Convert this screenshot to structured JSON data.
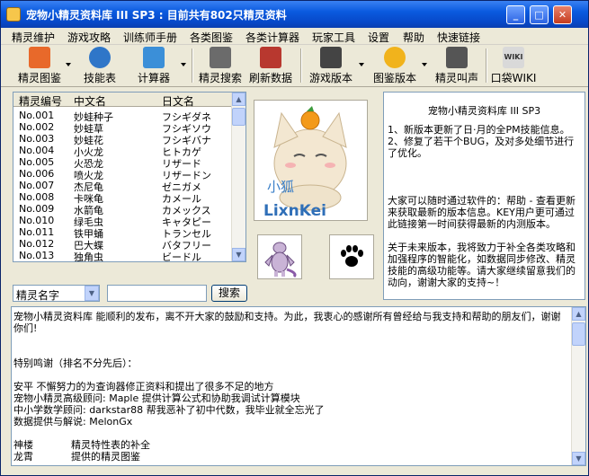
{
  "window": {
    "title": "宠物小精灵资料库 III SP3 : 目前共有802只精灵资料",
    "minimize": "_",
    "maximize": "□",
    "close": "✕"
  },
  "menu": [
    "精灵维护",
    "游戏攻略",
    "训练师手册",
    "各类图鉴",
    "各类计算器",
    "玩家工具",
    "设置",
    "帮助",
    "快速链接"
  ],
  "toolbar": [
    {
      "label": "精灵图鉴",
      "icon": "rss-book-icon",
      "color": "#e8692a",
      "dropdown": true
    },
    {
      "label": "技能表",
      "icon": "globe-icon",
      "color": "#2f76c8",
      "dropdown": false
    },
    {
      "label": "计算器",
      "icon": "calculator-icon",
      "color": "#3b8fd8",
      "dropdown": true
    },
    {
      "label": "精灵搜索",
      "icon": "magnifier-icon",
      "color": "#6b6b6b",
      "dropdown": false
    },
    {
      "label": "刷新数据",
      "icon": "refresh-icon",
      "color": "#b8382f",
      "dropdown": false
    },
    {
      "label": "游戏版本",
      "icon": "gamepad-icon",
      "color": "#444444",
      "dropdown": true
    },
    {
      "label": "图鉴版本",
      "icon": "smiley-icon",
      "color": "#f1b31c",
      "dropdown": true
    },
    {
      "label": "精灵叫声",
      "icon": "music-note-icon",
      "color": "#555555",
      "dropdown": false
    },
    {
      "label": "口袋WIKI",
      "icon": "wiki-icon",
      "color": "#d9d9d9",
      "dropdown": false
    }
  ],
  "list": {
    "headers": [
      "精灵编号",
      "中文名",
      "日文名"
    ],
    "rows": [
      [
        "No.001",
        "妙蛙种子",
        "フシギダネ"
      ],
      [
        "No.002",
        "妙蛙草",
        "フシギソウ"
      ],
      [
        "No.003",
        "妙蛙花",
        "フシギバナ"
      ],
      [
        "No.004",
        "小火龙",
        "ヒトカゲ"
      ],
      [
        "No.005",
        "火恐龙",
        "リザード"
      ],
      [
        "No.006",
        "喷火龙",
        "リザードン"
      ],
      [
        "No.007",
        "杰尼龟",
        "ゼニガメ"
      ],
      [
        "No.008",
        "卡咪龟",
        "カメール"
      ],
      [
        "No.009",
        "水箭龟",
        "カメックス"
      ],
      [
        "No.010",
        "绿毛虫",
        "キャタピー"
      ],
      [
        "No.011",
        "铁甲蛹",
        "トランセル"
      ],
      [
        "No.012",
        "巴大蝶",
        "バタフリー"
      ],
      [
        "No.013",
        "独角虫",
        "ビードル"
      ]
    ]
  },
  "search": {
    "field": "精灵名字",
    "value": "",
    "button": "搜索"
  },
  "avatar": {
    "name1": "小狐",
    "name2": "LixnKei"
  },
  "info": [
    "宠物小精灵资料库 III SP3",
    "    1、新版本更新了日·月的全PM技能信息。",
    "    2、修复了若干个BUG，及对多处细节进行了优化。",
    "",
    "    大家可以随时通过软件的：帮助 - 查看更新 来获取最新的版本信息。KEY用户更可通过此链接第一时间获得最新的内测版本。",
    "",
    "    关于未来版本，我将致力于补全各类攻略和加强程序的智能化，如数据同步修改、精灵技能的高级功能等。请大家继续留意我们的动向，谢谢大家的支持~！"
  ],
  "credits": [
    "宠物小精灵资料库 能顺利的发布，离不开大家的鼓励和支持。为此，我衷心的感谢所有曾经给与我支持和帮助的朋友们，谢谢你们!",
    "",
    "",
    "特别鸣谢（排名不分先后）：",
    "",
    "安平  不懈努力的为查询器修正资料和提出了很多不足的地方",
    "宠物小精灵高级顾问: Maple  提供计算公式和协助我调试计算模块",
    "中小学数学顾问: darkstar88 帮我恶补了初中代数，我毕业就全忘光了",
    "数据提供与解说: MelonGx",
    "",
    "神楼            精灵特性表的补全",
    "龙霄            提供的精灵图鉴"
  ]
}
